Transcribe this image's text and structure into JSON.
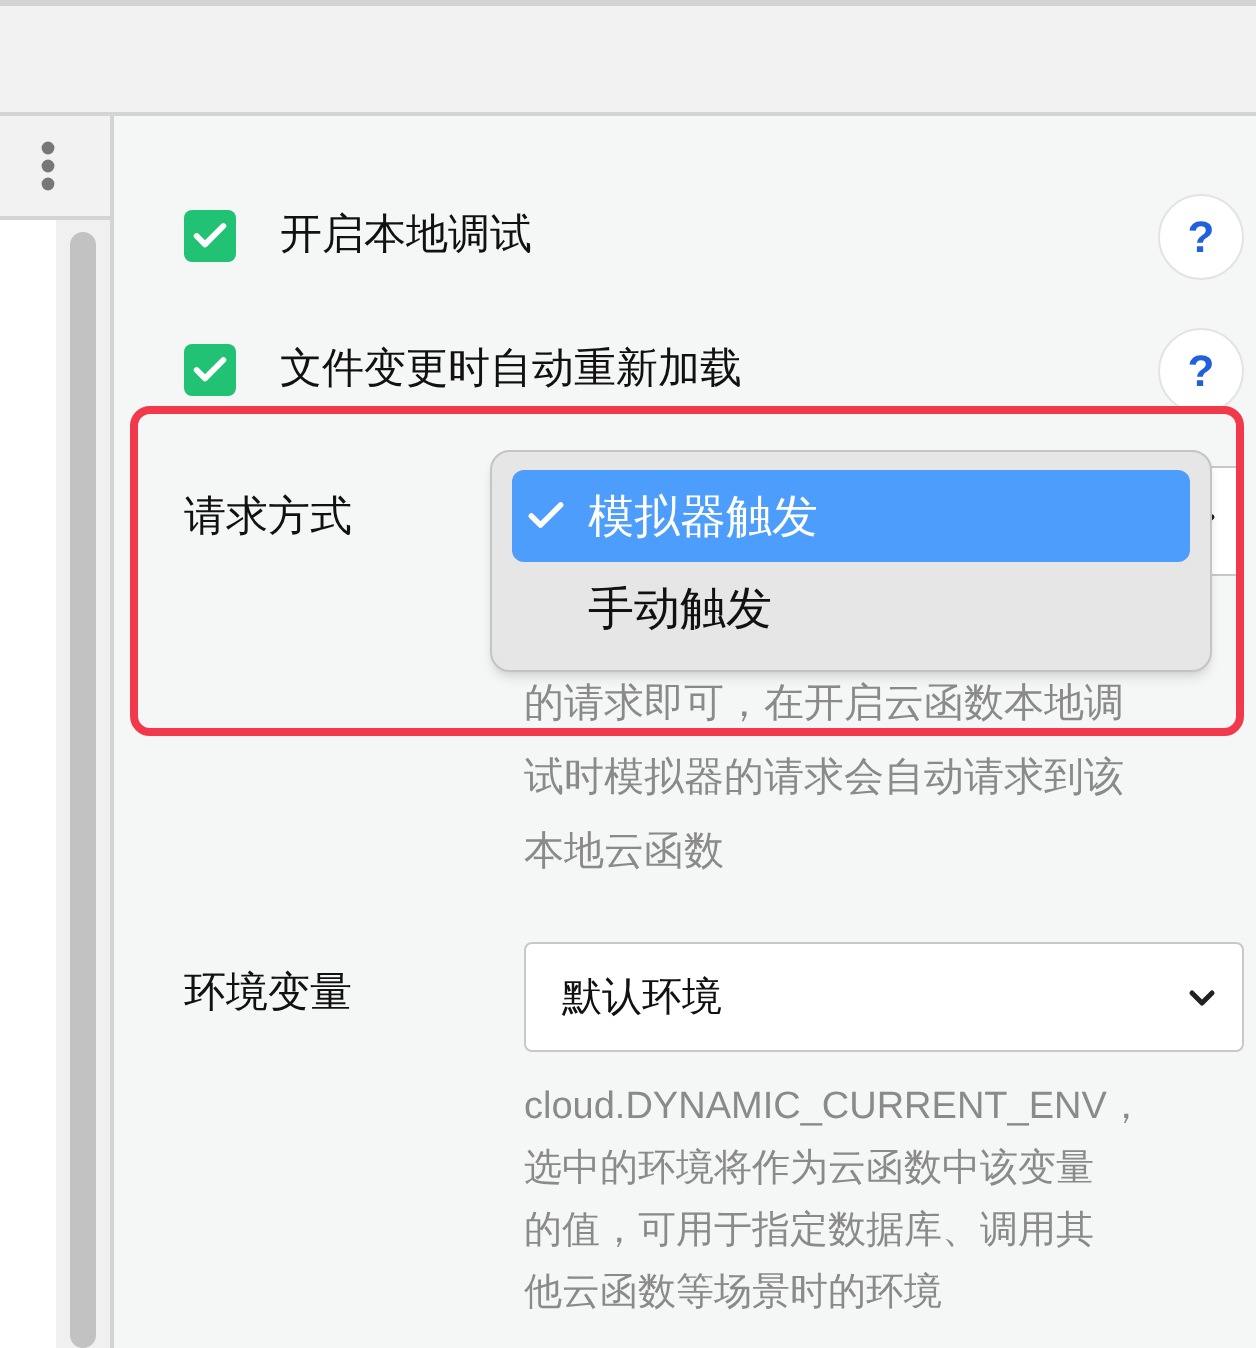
{
  "checkboxes": [
    {
      "label": "开启本地调试",
      "checked": true,
      "help": "?"
    },
    {
      "label": "文件变更时自动重新加载",
      "checked": true,
      "help": "?"
    }
  ],
  "request_method": {
    "label": "请求方式",
    "options": [
      {
        "label": "模拟器触发",
        "selected": true
      },
      {
        "label": "手动触发",
        "selected": false
      }
    ],
    "description_lines": [
      "的请求即可，在开启云函数本地调",
      "试时模拟器的请求会自动请求到该",
      "本地云函数"
    ]
  },
  "environment": {
    "label": "环境变量",
    "value": "默认环境",
    "description_lines": [
      "cloud.DYNAMIC_CURRENT_ENV，",
      "选中的环境将作为云函数中该变量",
      "的值，可用于指定数据库、调用其",
      "他云函数等场景时的环境"
    ]
  }
}
